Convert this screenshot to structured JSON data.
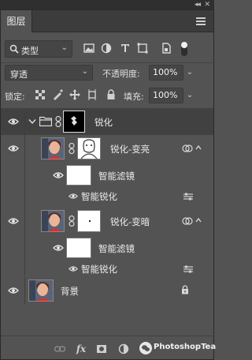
{
  "panel": {
    "tab_label": "图层",
    "collapse_glyph": "◂◂",
    "close_glyph": "✕"
  },
  "filter": {
    "kind_label": "类型",
    "icons": [
      "image-filter-icon",
      "adjustment-filter-icon",
      "type-filter-icon",
      "shape-filter-icon",
      "smart-object-filter-icon"
    ]
  },
  "blend": {
    "mode": "穿透",
    "opacity_label": "不透明度:",
    "opacity_value": "100%"
  },
  "lock": {
    "label": "锁定:",
    "fill_label": "填充:",
    "fill_value": "100%"
  },
  "layers": [
    {
      "name": "锐化",
      "type": "group"
    },
    {
      "name": "锐化-变亮",
      "type": "smart-object"
    },
    {
      "name": "智能滤镜",
      "type": "smart-filter-header"
    },
    {
      "name": "智能锐化",
      "type": "smart-filter"
    },
    {
      "name": "锐化-变暗",
      "type": "smart-object"
    },
    {
      "name": "智能滤镜",
      "type": "smart-filter-header"
    },
    {
      "name": "智能锐化",
      "type": "smart-filter"
    },
    {
      "name": "背景",
      "type": "background"
    }
  ],
  "bottom": {
    "fx_label": "fx",
    "watermark": "PhotoshopTea"
  },
  "colors": {
    "panel_bg": "#535353",
    "selected_bg": "#414141",
    "tab_bg": "#3c3c3c"
  }
}
